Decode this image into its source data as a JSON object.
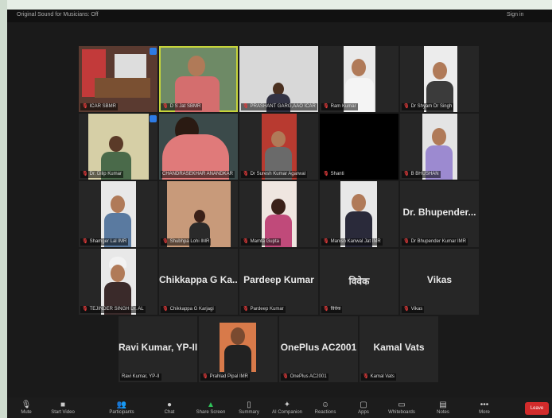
{
  "topbar": {
    "sound_label": "Original Sound for Musicians: Off",
    "signin": "Sign in"
  },
  "tiles": [
    {
      "caption": "ICAR SBMR",
      "big": ""
    },
    {
      "caption": "D S Jat SBMR",
      "big": ""
    },
    {
      "caption": "PRASHANT GARG,AAO ICAR",
      "big": ""
    },
    {
      "caption": "Ram Kumar",
      "big": ""
    },
    {
      "caption": "Dr Shyam Dr Singh",
      "big": ""
    },
    {
      "caption": "Dr. Dilip Kumar",
      "big": ""
    },
    {
      "caption": "CHANDRASEKHAR ANANDKAR",
      "big": ""
    },
    {
      "caption": "Dr Suresh Kumar Agarwal",
      "big": ""
    },
    {
      "caption": "Shanti",
      "big": ""
    },
    {
      "caption": "B BHUSHAN",
      "big": ""
    },
    {
      "caption": "Shamger Lal IMR",
      "big": ""
    },
    {
      "caption": "Shubhpa Lohi IMR",
      "big": ""
    },
    {
      "caption": "Mamta Gupta",
      "big": ""
    },
    {
      "caption": "Manish Kanwal Jat IMR",
      "big": ""
    },
    {
      "caption": "Dr Bhupender Kumar IMR",
      "big": "Dr. Bhupender..."
    },
    {
      "caption": "TEJINDER SINGH Dr. AL",
      "big": ""
    },
    {
      "caption": "Chikkappa G Karjagi",
      "big": "Chikkappa G Ka..."
    },
    {
      "caption": "Pardeep Kumar",
      "big": "Pardeep Kumar"
    },
    {
      "caption": "विवेक",
      "big": "विवेक"
    },
    {
      "caption": "Vikas",
      "big": "Vikas"
    },
    {
      "caption": "Ravi Kumar, YP-II",
      "big": "Ravi Kumar, YP-II"
    },
    {
      "caption": "Prahlad Pipal IMR",
      "big": ""
    },
    {
      "caption": "OnePlus AC2001",
      "big": "OnePlus AC2001"
    },
    {
      "caption": "Kamal Vats",
      "big": "Kamal Vats"
    }
  ],
  "toolbar": [
    {
      "label": "Mute",
      "icon": "microphone-icon",
      "glyph": "🎙"
    },
    {
      "label": "Start Video",
      "icon": "video-camera-icon",
      "glyph": "■"
    },
    {
      "label": "Participants",
      "icon": "participants-icon",
      "glyph": "👥"
    },
    {
      "label": "Chat",
      "icon": "chat-icon",
      "glyph": "●"
    },
    {
      "label": "Share Screen",
      "icon": "share-screen-icon",
      "glyph": "▲"
    },
    {
      "label": "Summary",
      "icon": "summary-icon",
      "glyph": "▯"
    },
    {
      "label": "AI Companion",
      "icon": "ai-companion-icon",
      "glyph": "✦"
    },
    {
      "label": "Reactions",
      "icon": "reactions-icon",
      "glyph": "☺"
    },
    {
      "label": "Apps",
      "icon": "apps-icon",
      "glyph": "▢"
    },
    {
      "label": "Whiteboards",
      "icon": "whiteboard-icon",
      "glyph": "▭"
    },
    {
      "label": "Notes",
      "icon": "notes-icon",
      "glyph": "▤"
    },
    {
      "label": "More",
      "icon": "more-icon",
      "glyph": "•••"
    }
  ],
  "leave_label": "Leave",
  "colors": {
    "accent": "#c7d43a",
    "leave": "#d22b2b",
    "mic_muted": "#e23b3b",
    "pinned": "#2d7be5"
  }
}
